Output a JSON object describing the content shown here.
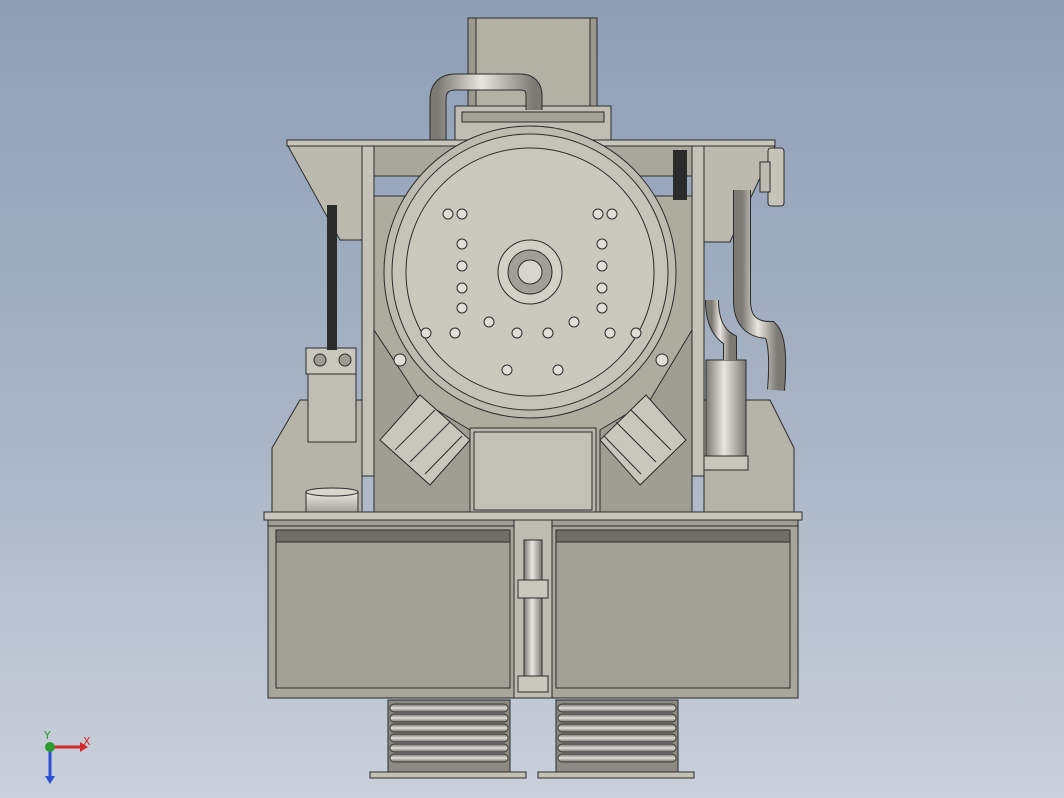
{
  "viewport": {
    "background_top": "#8e9fb6",
    "background_bottom": "#c9d0db",
    "model": {
      "fill": "#b3b1a4",
      "fill_light": "#cfcdc2",
      "fill_dark": "#8f8d82",
      "edge": "#2b2b2b",
      "base_band": "#6f6e68",
      "bellows_light": "#e2e0d8",
      "bellows_dark": "#6c6b66"
    }
  },
  "triad": {
    "x_label": "X",
    "y_label": "Y",
    "x_color": "#d42a2a",
    "y_color": "#2e9b2e",
    "z_color": "#2a4fd4"
  }
}
